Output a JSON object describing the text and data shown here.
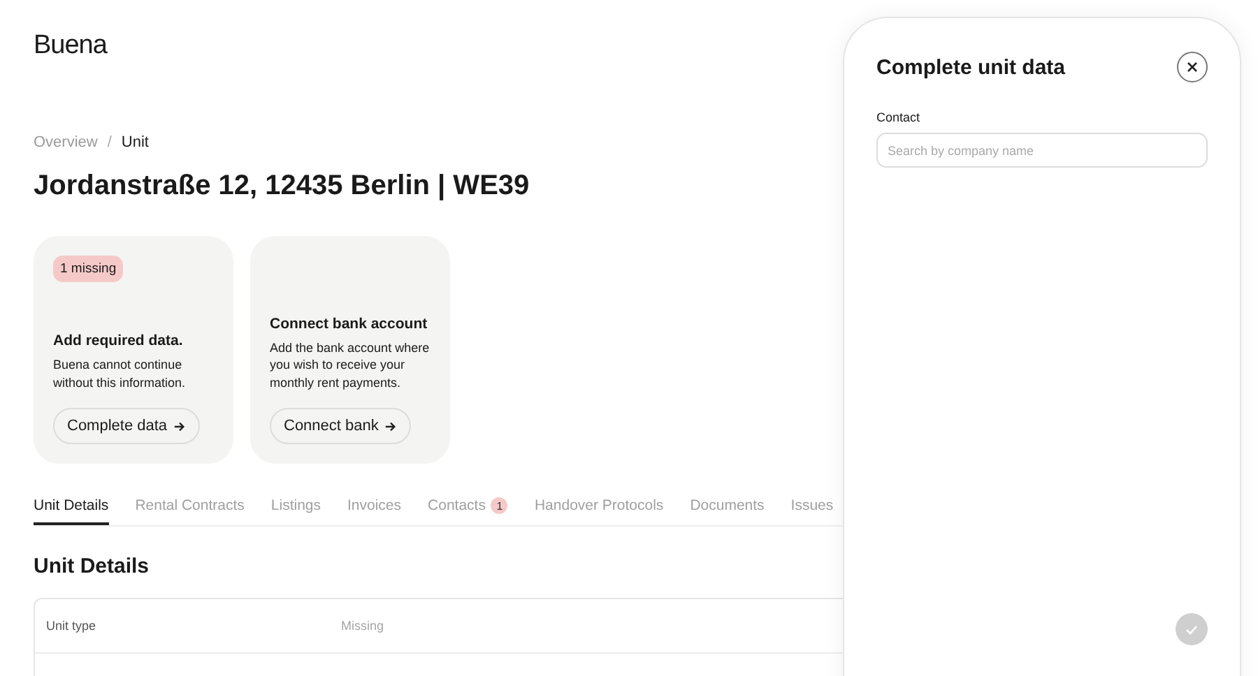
{
  "logo": "Buena",
  "breadcrumb": [
    "Overview",
    "Unit"
  ],
  "breadcrumb_separator": "/",
  "title": "Jordanstraße 12, 12435 Berlin | WE39",
  "cards": [
    {
      "badge": "1 missing",
      "heading": "Add required data.",
      "text": "Buena cannot continue without this information.",
      "button": "Complete data"
    },
    {
      "heading": "Connect bank account",
      "text": "Add the bank account where you wish to receive your monthly rent payments.",
      "button": "Connect bank"
    }
  ],
  "tabs": [
    {
      "label": "Unit Details",
      "selected": true
    },
    {
      "label": "Rental Contracts",
      "selected": false
    },
    {
      "label": "Listings",
      "selected": false
    },
    {
      "label": "Invoices",
      "selected": false
    },
    {
      "label": "Contacts",
      "selected": false,
      "count": "1"
    },
    {
      "label": "Handover Protocols",
      "selected": false
    },
    {
      "label": "Documents",
      "selected": false
    },
    {
      "label": "Issues",
      "selected": false
    }
  ],
  "section_title": "Unit Details",
  "table": {
    "rows": [
      {
        "label": "Unit type",
        "value": "Missing"
      }
    ]
  },
  "panel": {
    "title": "Complete unit data",
    "field_label": "Contact",
    "placeholder": "Search by company name",
    "submit_disabled": true
  }
}
